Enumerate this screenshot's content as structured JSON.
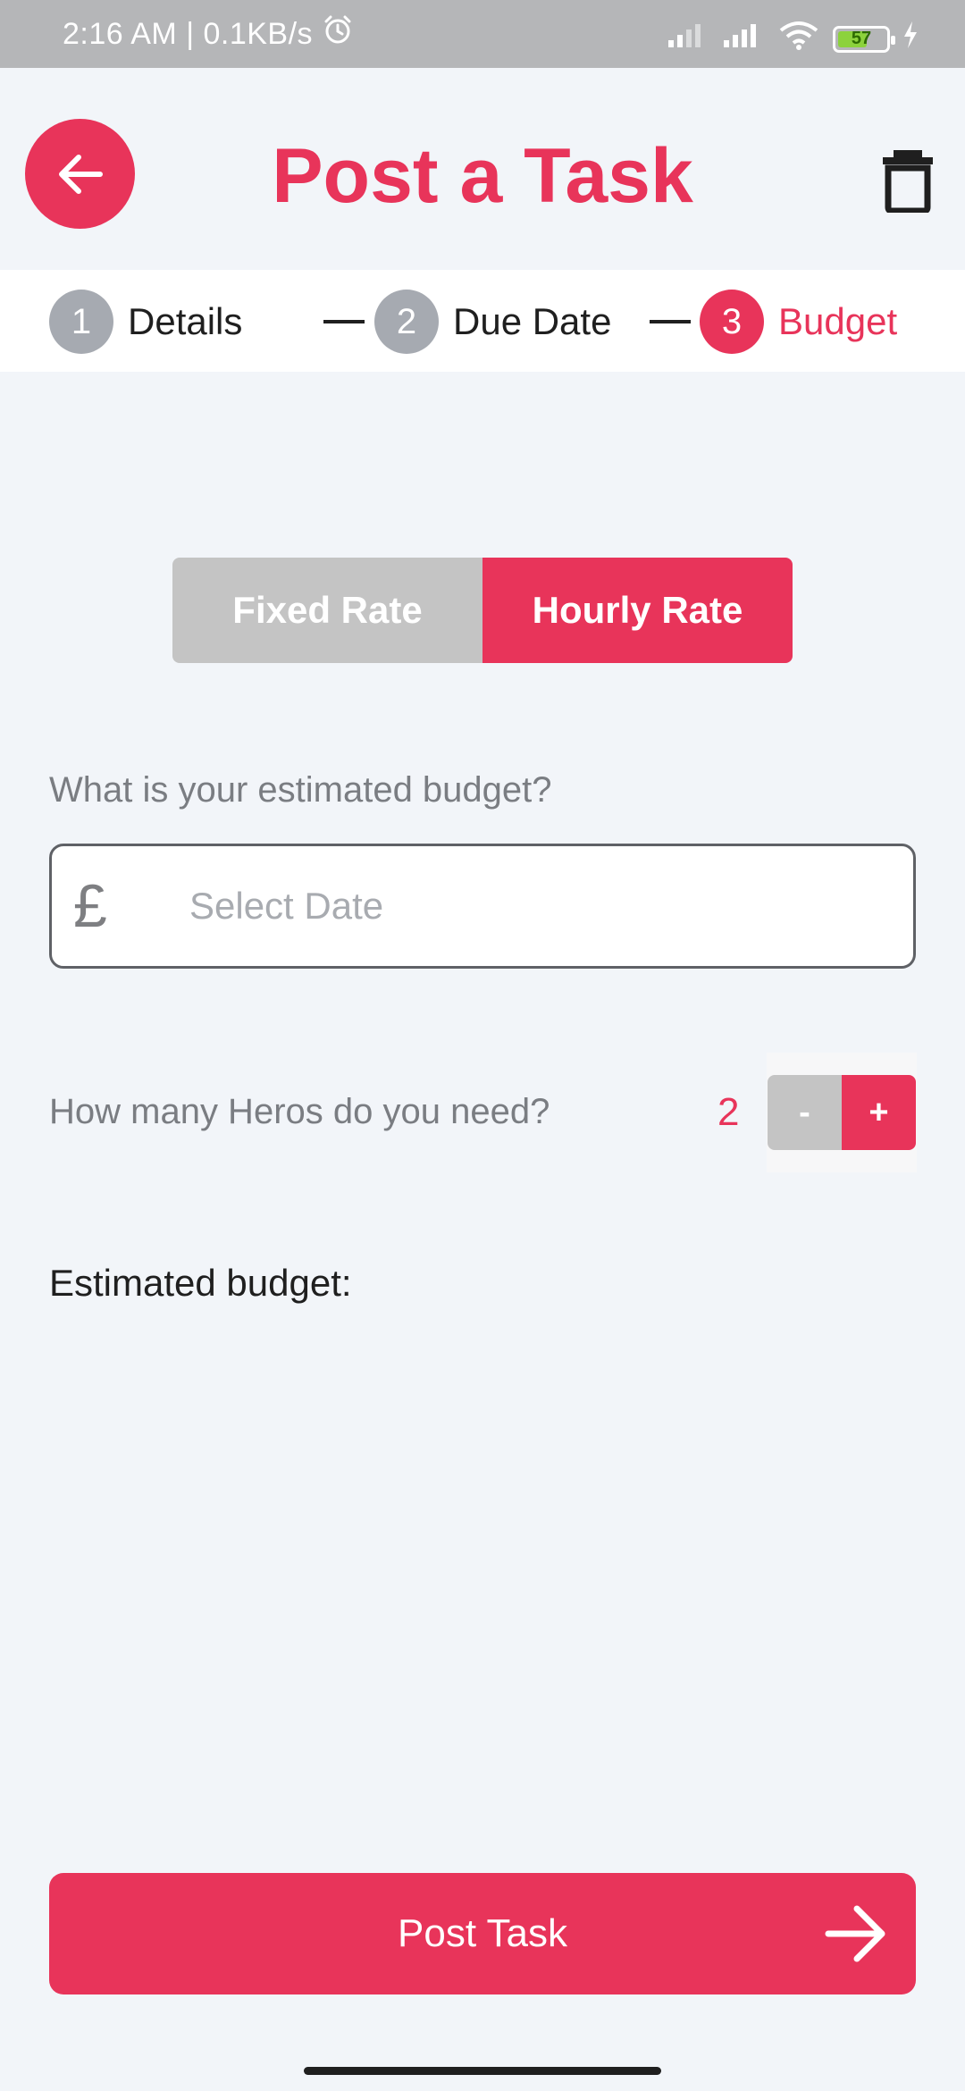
{
  "status_bar": {
    "time": "2:16 AM | 0.1KB/s",
    "battery_level": "57",
    "icons": [
      "alarm-icon",
      "signal-icon",
      "signal-icon",
      "wifi-icon",
      "battery-icon",
      "charging-icon"
    ]
  },
  "header": {
    "title": "Post a Task",
    "back_icon": "arrow-left-icon",
    "delete_icon": "trash-icon"
  },
  "steps": [
    {
      "number": "1",
      "label": "Details",
      "active": false
    },
    {
      "number": "2",
      "label": "Due Date",
      "active": false
    },
    {
      "number": "3",
      "label": "Budget",
      "active": true
    }
  ],
  "rate_toggle": {
    "fixed_label": "Fixed Rate",
    "hourly_label": "Hourly Rate",
    "selected": "Hourly Rate"
  },
  "budget": {
    "question": "What is your estimated budget?",
    "currency_symbol": "£",
    "placeholder": "Select Date",
    "value": ""
  },
  "heros": {
    "question": "How many Heros do you need?",
    "count": "2",
    "minus_label": "-",
    "plus_label": "+"
  },
  "estimated_label": "Estimated budget:",
  "post_button": {
    "label": "Post Task",
    "icon": "arrow-right-icon"
  },
  "colors": {
    "accent": "#e8345a",
    "inactive": "#c4c4c4",
    "step_inactive": "#a6aab1",
    "background": "#f2f5f9"
  }
}
